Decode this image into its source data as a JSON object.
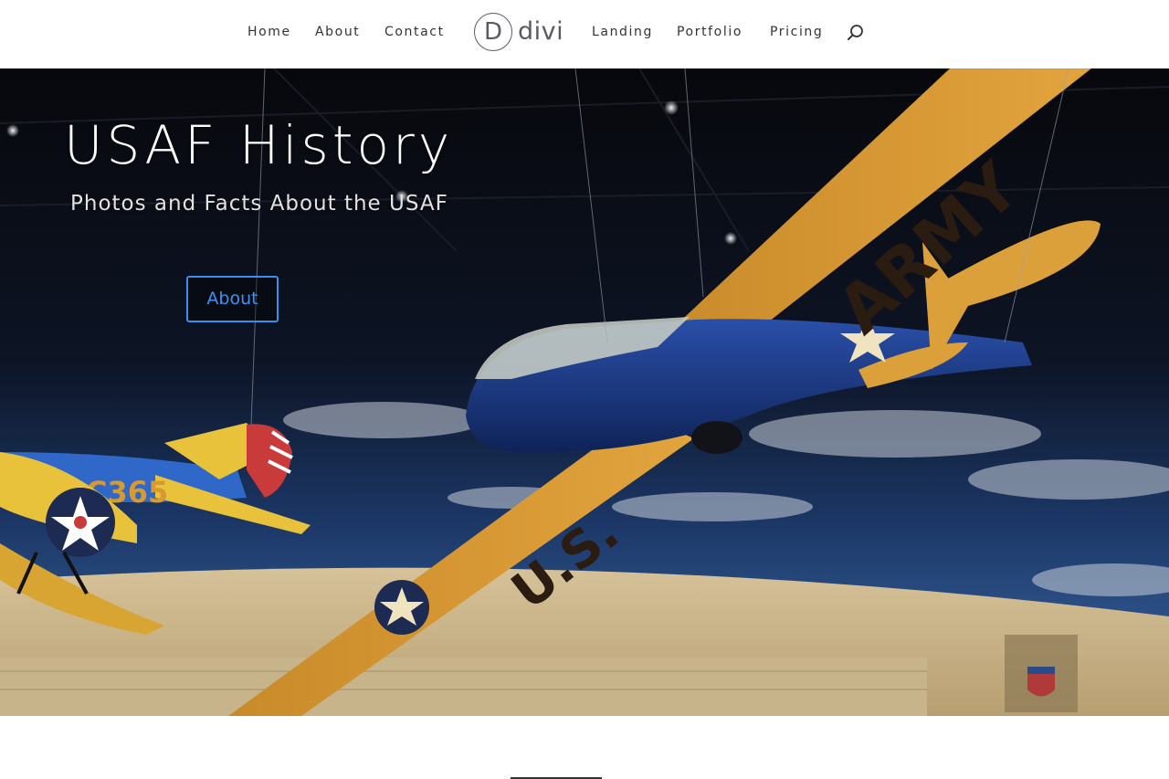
{
  "nav": {
    "left_items": [
      {
        "label": "Home"
      },
      {
        "label": "About"
      },
      {
        "label": "Contact"
      }
    ],
    "right_items": [
      {
        "label": "Landing"
      },
      {
        "label": "Portfolio"
      },
      {
        "label": "Pricing"
      }
    ],
    "logo": {
      "letter": "D",
      "word": "divi"
    },
    "search_icon": "search-icon"
  },
  "hero": {
    "title": "USAF History",
    "subtitle": "Photos and Facts About the USAF",
    "button_label": "About",
    "plane_markings": {
      "glider_wing_top": "ARMY",
      "glider_wing_bottom": "U.S.",
      "biplane_code": "C365"
    }
  },
  "colors": {
    "nav_text": "#333333",
    "logo": "#5a5a64",
    "button_accent": "#3a8ef0",
    "hero_title": "#ffffff"
  }
}
